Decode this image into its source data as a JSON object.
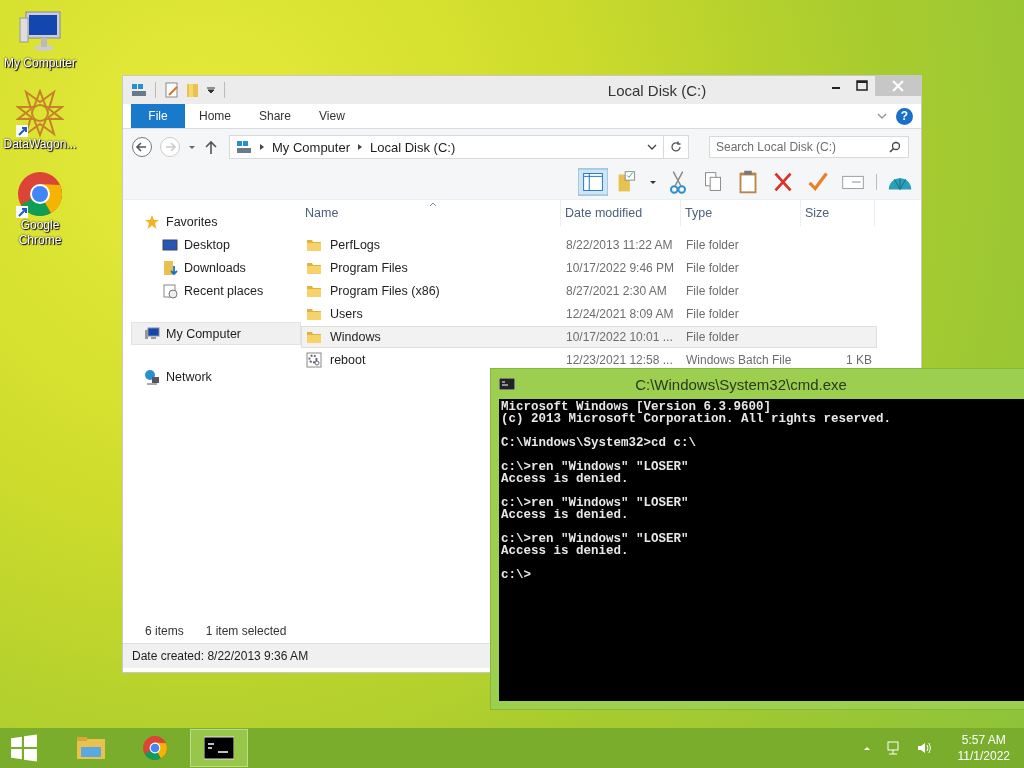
{
  "desktop_icons": [
    {
      "label": "My Computer",
      "kind": "computer"
    },
    {
      "label": "DataWagon...",
      "kind": "star",
      "shortcut": true
    },
    {
      "label": "Google Chrome",
      "kind": "chrome",
      "shortcut": true
    }
  ],
  "explorer": {
    "title": "Local Disk (C:)",
    "ribbon_tabs": [
      {
        "label": "File",
        "kind": "file",
        "selected": false
      },
      {
        "label": "Home",
        "kind": "tab",
        "selected": false
      },
      {
        "label": "Share",
        "kind": "tab",
        "selected": false
      },
      {
        "label": "View",
        "kind": "tab",
        "selected": false
      }
    ],
    "address": [
      "My Computer",
      "Local Disk (C:)"
    ],
    "help": "?",
    "search": {
      "placeholder": "Search Local Disk (C:)"
    },
    "nav": [
      {
        "label": "Favorites",
        "kind": "star",
        "selected": false,
        "children": [
          {
            "label": "Desktop",
            "kind": "desktop",
            "selected": false
          },
          {
            "label": "Downloads",
            "kind": "downloads",
            "selected": false
          },
          {
            "label": "Recent places",
            "kind": "recent",
            "selected": false
          }
        ]
      },
      {
        "label": "My Computer",
        "kind": "computer",
        "selected": true
      },
      {
        "label": "Network",
        "kind": "network",
        "selected": false
      }
    ],
    "columns": [
      "Name",
      "Date modified",
      "Type",
      "Size"
    ],
    "rows": [
      {
        "name": "PerfLogs",
        "kind": "folder",
        "date": "8/22/2013 11:22 AM",
        "type": "File folder",
        "selected": false
      },
      {
        "name": "Program Files",
        "kind": "folder",
        "date": "10/17/2022 9:46 PM",
        "type": "File folder",
        "selected": false
      },
      {
        "name": "Program Files (x86)",
        "kind": "folder",
        "date": "8/27/2021 2:30 AM",
        "type": "File folder",
        "selected": false
      },
      {
        "name": "Users",
        "kind": "folder",
        "date": "12/24/2021 8:09 AM",
        "type": "File folder",
        "selected": false
      },
      {
        "name": "Windows",
        "kind": "folder",
        "date": "10/17/2022 10:01 ...",
        "type": "File folder",
        "selected": true
      },
      {
        "name": "reboot",
        "kind": "batch",
        "date": "12/23/2021 12:58 ...",
        "type": "Windows Batch File",
        "size": "1 KB",
        "selected": false
      }
    ],
    "item_count": "6 items",
    "selection_status": "1 item selected",
    "details": "Date created: 8/22/2013 9:36 AM"
  },
  "console": {
    "title": "C:\\Windows\\System32\\cmd.exe",
    "paragraphs": [
      [
        "Microsoft Windows [Version 6.3.9600]",
        "(c) 2013 Microsoft Corporation. All rights reserved."
      ],
      [
        "C:\\Windows\\System32>cd c:\\"
      ],
      [
        "c:\\>ren \"Windows\" \"LOSER\"",
        "Access is denied."
      ],
      [
        "c:\\>ren \"Windows\" \"LOSER\"",
        "Access is denied."
      ],
      [
        "c:\\>ren \"Windows\" \"LOSER\"",
        "Access is denied."
      ],
      [
        "c:\\>"
      ]
    ]
  },
  "taskbar": {
    "items": [
      {
        "kind": "explorer",
        "selected": false
      },
      {
        "kind": "chrome",
        "selected": false
      },
      {
        "kind": "console",
        "selected": true
      }
    ],
    "time": "5:57 AM",
    "date": "11/1/2022"
  }
}
